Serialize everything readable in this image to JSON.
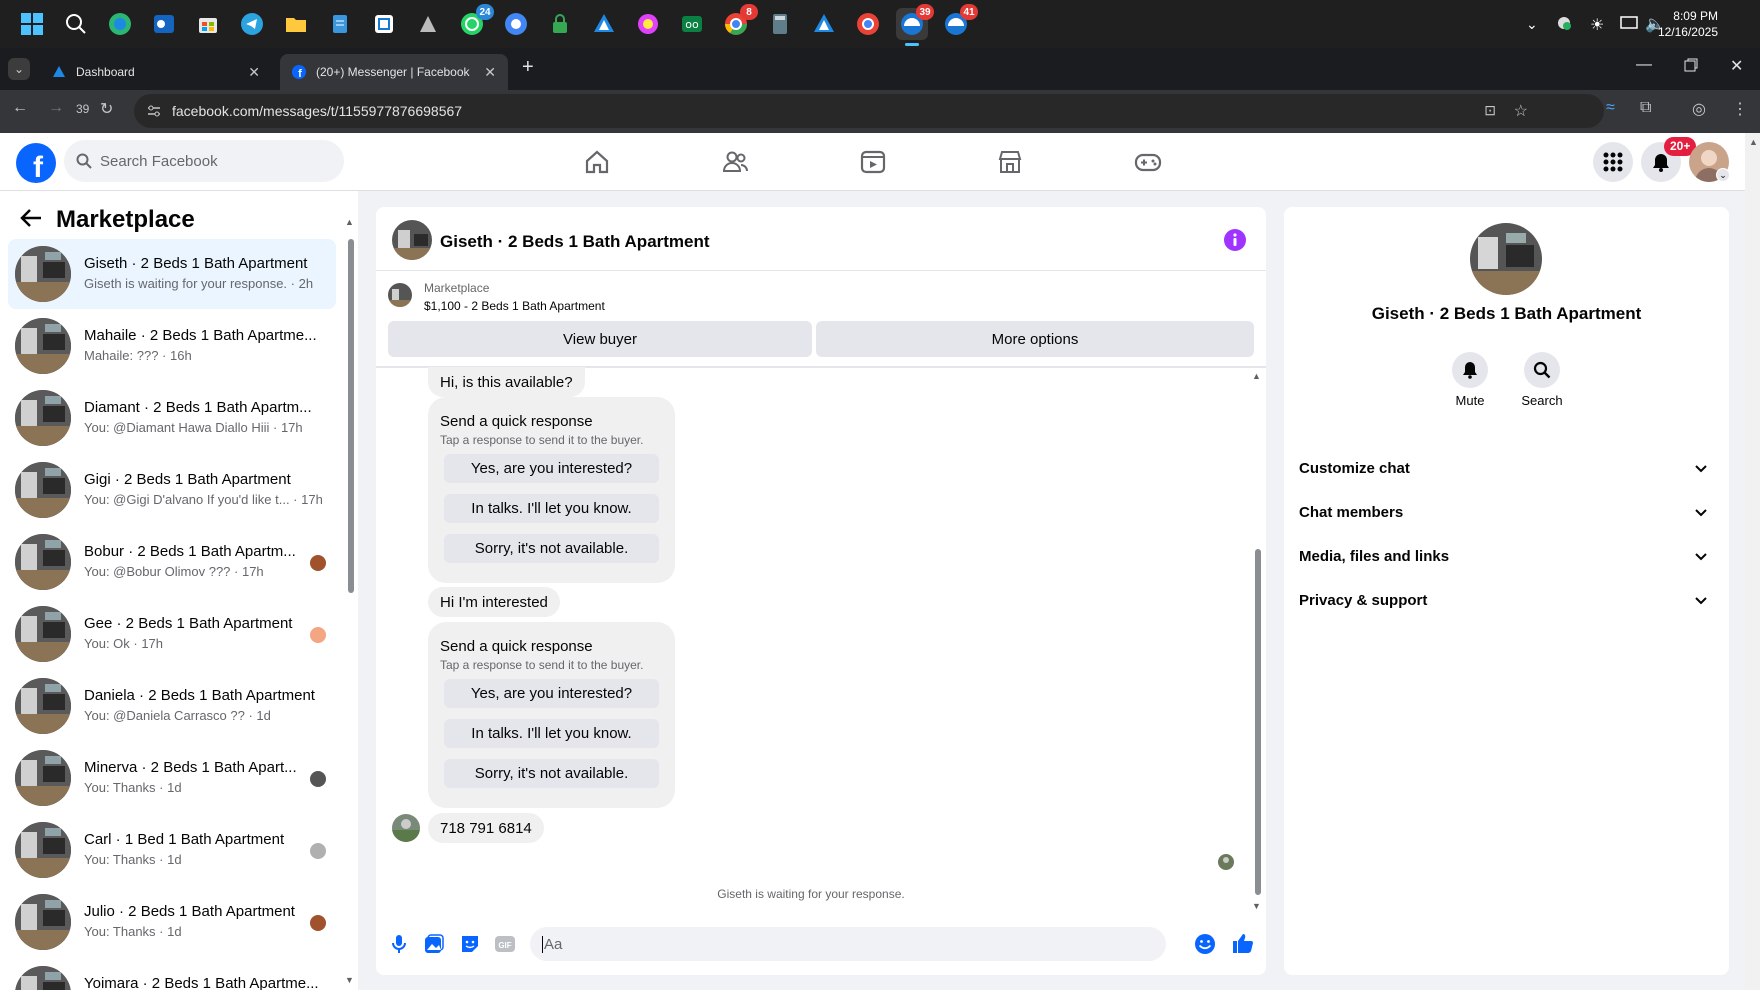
{
  "taskbar": {
    "icons": [
      "windows-start",
      "search",
      "edge-copilot",
      "outlook",
      "store",
      "telegram",
      "file-explorer",
      "notepad",
      "snipping-tool",
      "tool-app",
      "whatsapp",
      "chrome-alt",
      "lock-app",
      "drive",
      "color-app",
      "infinity-app",
      "chrome",
      "calculator",
      "drive-alt",
      "chrome-profile",
      "app-39",
      "app-41"
    ],
    "whatsapp_badge": "24",
    "chrome_badge": "8",
    "app39_badge": "39",
    "app41_badge": "41",
    "time": "8:09 PM",
    "date": "12/16/2025"
  },
  "browser": {
    "tabs": [
      {
        "label": "Dashboard"
      },
      {
        "label": "(20+) Messenger | Facebook"
      }
    ],
    "tab_count": "39",
    "url": "facebook.com/messages/t/1155977876698567"
  },
  "fb": {
    "search_placeholder": "Search Facebook",
    "notif_badge": "20+"
  },
  "sidebar": {
    "title": "Marketplace",
    "conversations": [
      {
        "title": "Giseth · 2 Beds 1 Bath Apartment",
        "sub": "Giseth is waiting for your response. · 2h",
        "selected": true
      },
      {
        "title": "Mahaile · 2 Beds 1 Bath Apartme...",
        "sub": "Mahaile: ??? · 16h"
      },
      {
        "title": "Diamant · 2 Beds 1 Bath Apartm...",
        "sub": "You: @Diamant Hawa Diallo Hiii · 17h"
      },
      {
        "title": "Gigi · 2 Beds 1 Bath Apartment",
        "sub": "You: @Gigi D'alvano If you'd like t... · 17h"
      },
      {
        "title": "Bobur · 2 Beds 1 Bath Apartm...",
        "sub": "You: @Bobur Olimov ??? · 17h"
      },
      {
        "title": "Gee · 2 Beds 1 Bath Apartment",
        "sub": "You: Ok · 17h"
      },
      {
        "title": "Daniela · 2 Beds 1 Bath Apartment",
        "sub": "You: @Daniela Carrasco ?? · 1d"
      },
      {
        "title": "Minerva · 2 Beds 1 Bath Apart...",
        "sub": "You: Thanks · 1d"
      },
      {
        "title": "Carl · 1 Bed 1 Bath Apartment",
        "sub": "You: Thanks · 1d"
      },
      {
        "title": "Julio · 2 Beds 1 Bath Apartment",
        "sub": "You: Thanks · 1d"
      },
      {
        "title": "Yoimara · 2 Beds 1 Bath Apartme...",
        "sub": ""
      }
    ]
  },
  "chat": {
    "title": "Giseth · 2 Beds 1 Bath Apartment",
    "listing_source": "Marketplace",
    "listing": "$1,100 - 2 Beds 1 Bath Apartment",
    "view_buyer": "View buyer",
    "more_options": "More options",
    "msg1": "Hi, is this available?",
    "quick_title": "Send a quick response",
    "quick_sub": "Tap a response to send it to the buyer.",
    "quick_options": [
      "Yes, are you interested?",
      "In talks. I'll let you know.",
      "Sorry, it's not available."
    ],
    "msg2": "Hi I'm interested",
    "msg3": "718 791 6814",
    "waiting": "Giseth is waiting for your response.",
    "composer_placeholder": "Aa"
  },
  "details": {
    "name": "Giseth · 2 Beds 1 Bath Apartment",
    "mute": "Mute",
    "search": "Search",
    "sections": [
      "Customize chat",
      "Chat members",
      "Media, files and links",
      "Privacy & support"
    ]
  },
  "colors": {
    "fb_blue": "#0866ff",
    "messenger_purple": "#a033ff",
    "notif_red": "#e41e3f"
  }
}
